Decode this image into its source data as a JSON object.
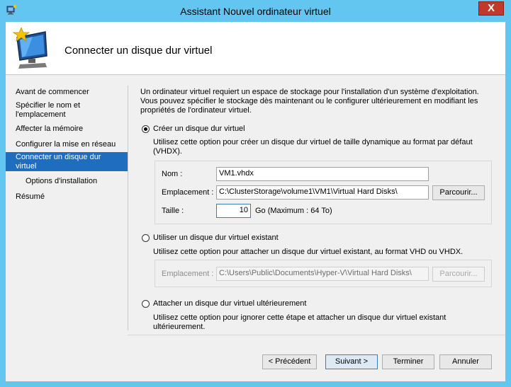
{
  "window": {
    "title": "Assistant Nouvel ordinateur virtuel",
    "close_label": "X",
    "colors": {
      "frame": "#62c6f0",
      "close": "#c0392b",
      "nav_selected": "#1e6dbf"
    }
  },
  "header": {
    "title": "Connecter un disque dur virtuel"
  },
  "nav": {
    "items": [
      {
        "label": "Avant de commencer",
        "selected": false
      },
      {
        "label": "Spécifier le nom et l'emplacement",
        "selected": false
      },
      {
        "label": "Affecter la mémoire",
        "selected": false
      },
      {
        "label": "Configurer la mise en réseau",
        "selected": false
      },
      {
        "label": "Connecter un disque dur virtuel",
        "selected": true
      },
      {
        "label": "Options d'installation",
        "selected": false
      },
      {
        "label": "Résumé",
        "selected": false
      }
    ]
  },
  "main": {
    "intro": "Un ordinateur virtuel requiert un espace de stockage pour l'installation d'un système d'exploitation. Vous pouvez spécifier le stockage dès maintenant ou le configurer ultérieurement en modifiant les propriétés de l'ordinateur virtuel.",
    "option_create": {
      "label": "Créer un disque dur virtuel",
      "selected": true,
      "description": "Utilisez cette option pour créer un disque dur virtuel de taille dynamique au format par défaut (VHDX).",
      "name_label": "Nom :",
      "name_value": "VM1.vhdx",
      "location_label": "Emplacement :",
      "location_value": "C:\\ClusterStorage\\volume1\\VM1\\Virtual Hard Disks\\",
      "browse_label": "Parcourir...",
      "size_label": "Taille :",
      "size_value": "10",
      "size_unit": "Go (Maximum : 64 To)"
    },
    "option_existing": {
      "label": "Utiliser un disque dur virtuel existant",
      "selected": false,
      "description": "Utilisez cette option pour attacher un disque dur virtuel existant, au format VHD ou VHDX.",
      "location_label": "Emplacement :",
      "location_value": "C:\\Users\\Public\\Documents\\Hyper-V\\Virtual Hard Disks\\",
      "browse_label": "Parcourir..."
    },
    "option_later": {
      "label": "Attacher un disque dur virtuel ultérieurement",
      "selected": false,
      "description": "Utilisez cette option pour ignorer cette étape et attacher un disque dur virtuel existant ultérieurement."
    }
  },
  "footer": {
    "previous": "< Précédent",
    "next": "Suivant >",
    "finish": "Terminer",
    "cancel": "Annuler"
  }
}
